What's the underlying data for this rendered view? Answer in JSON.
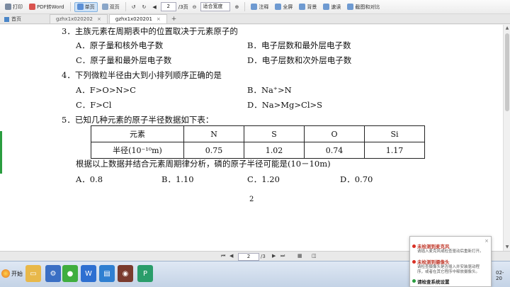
{
  "toolbar": {
    "print": "打印",
    "pdf_to_word": "PDF转Word",
    "single_page": "单页",
    "double_page": "双页",
    "page_input": "2",
    "page_total": "/3页",
    "zoom": "适合宽度",
    "notes": "注释",
    "full_screen": "全屏",
    "background": "背景",
    "read_mode": "速读",
    "screenshot": "截图和对比"
  },
  "tabs": {
    "home": "首页",
    "items": [
      "gzhx1x020202",
      "gzhx1x020201"
    ],
    "new_tab": "+"
  },
  "document": {
    "q3": {
      "stem": "3．主族元素在周期表中的位置取决于元素原子的",
      "A": "A．原子量和核外电子数",
      "B": "B．电子层数和最外层电子数",
      "C": "C．原子量和最外层电子数",
      "D": "D．电子层数和次外层电子数"
    },
    "q4": {
      "stem": "4．下列微粒半径由大到小排列顺序正确的是",
      "A": "A．F>O>N>C",
      "B": "B．Na⁺>N",
      "C": "C．F>Cl",
      "D": "D．Na>Mg>Cl>S"
    },
    "q5": {
      "stem": "5．已知几种元素的原子半径数据如下表：",
      "table": {
        "row1_label": "元素",
        "row2_label": "半径(10⁻¹⁰m)",
        "elements": [
          "N",
          "S",
          "O",
          "Si"
        ],
        "radii": [
          "0.75",
          "1.02",
          "0.74",
          "1.17"
        ]
      },
      "question": "根据以上数据并结合元素周期律分析，磷的原子半径可能是(10－10m)",
      "A": "A．0.8",
      "B": "B．1.10",
      "C": "C．1.20",
      "D": "D．0.70"
    },
    "page_number": "2"
  },
  "navbar": {
    "page_input": "2",
    "page_total": "/3"
  },
  "taskbar": {
    "start_label": "开始",
    "clock": "02-20"
  },
  "notifications": [
    {
      "title": "未检测到麦克风",
      "desc": "请插入麦克风或检查驱动后重新打开。"
    },
    {
      "title": "未检测到摄像头",
      "desc": "请检查摄像头是否插入并安装驱动程序，或者在其它程序中释放摄像头。"
    },
    {
      "title": "请检查系统设置",
      "desc": ""
    }
  ],
  "colors": {
    "accent": "#2f7fd1",
    "doc_bg": "#ffffff",
    "alert_red": "#d93025",
    "ok_green": "#2a9d3f"
  }
}
